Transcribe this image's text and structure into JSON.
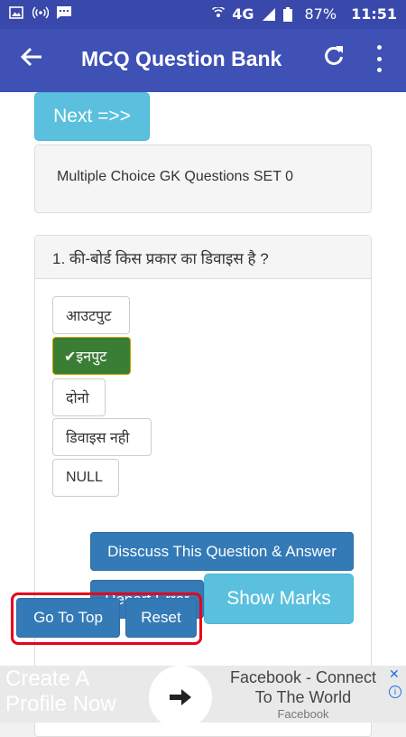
{
  "status_bar": {
    "network": "4G",
    "battery": "87%",
    "time": "11:51"
  },
  "app_bar": {
    "title": "MCQ Question Bank",
    "back_icon": "back-arrow-icon",
    "refresh_icon": "refresh-icon",
    "more_icon": "more-vert-icon"
  },
  "content": {
    "next_button": "Next =>>",
    "set_title": "Multiple Choice GK Questions SET 0",
    "question": "1. की-बोर्ड किस प्रकार का डिवाइस है ?",
    "options": [
      {
        "label": "आउटपुट",
        "correct": false
      },
      {
        "label": "✔इनपुट",
        "correct": true
      },
      {
        "label": "दोनो",
        "correct": false
      },
      {
        "label": "डिवाइस नही",
        "correct": false
      },
      {
        "label": "NULL",
        "correct": false
      }
    ],
    "discuss_button": "Disscuss This Question & Answer",
    "report_button": "Report Error",
    "show_marks_button": "Show Marks",
    "go_to_top_button": "Go To Top",
    "reset_button": "Reset"
  },
  "ad": {
    "left_text": "Create A Profile Now",
    "right_title": "Facebook - Connect To The World",
    "advertiser": "Facebook",
    "close_icon": "close-icon",
    "info_icon": "info-icon"
  },
  "colors": {
    "status_bar": "#3949ab",
    "app_bar": "#3f51b5",
    "info_button": "#5bc0de",
    "primary_button": "#337ab7",
    "correct_option": "#3a7d34",
    "highlight_frame": "#e8001c"
  }
}
